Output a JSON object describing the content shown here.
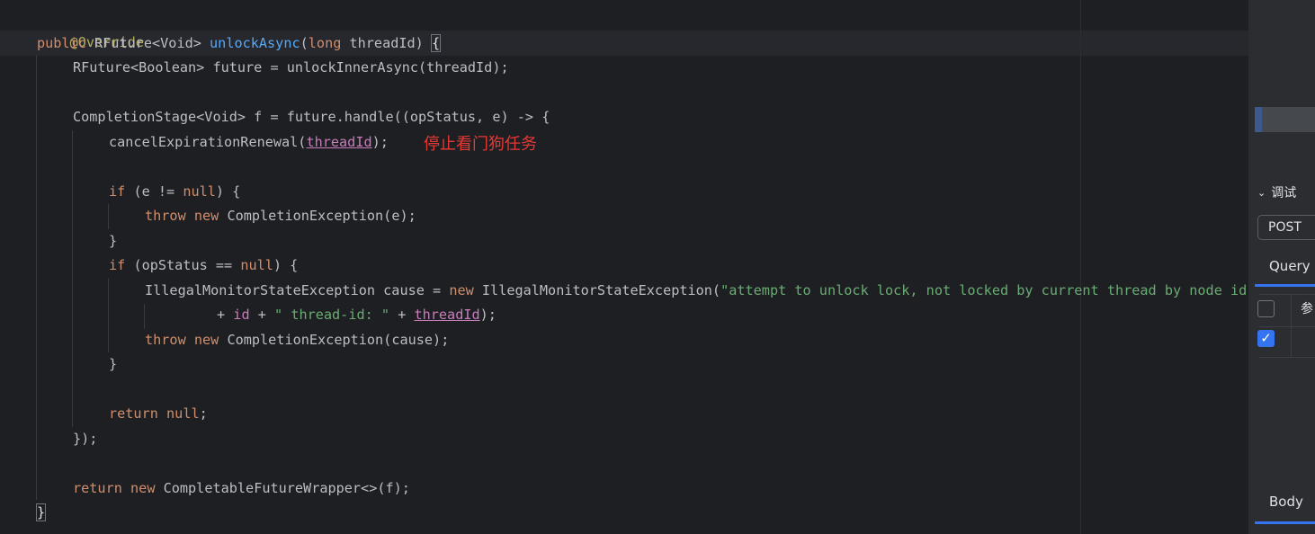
{
  "editor": {
    "lines": {
      "l1": [
        "@Override"
      ],
      "l2": [
        "public",
        " RFuture<Void> ",
        "unlockAsync",
        "(",
        "long",
        " threadId) ",
        "{"
      ],
      "l3": [
        "RFuture<Boolean> future = unlockInnerAsync(threadId);"
      ],
      "l5": [
        "CompletionStage<Void> f = future.handle((opStatus, e) -> {"
      ],
      "l6": [
        "cancelExpirationRenewal(",
        "threadId",
        ");"
      ],
      "l8": [
        "if",
        " (e != ",
        "null",
        ") {"
      ],
      "l9": [
        "throw",
        " ",
        "new",
        " CompletionException(e);"
      ],
      "l10": [
        "}"
      ],
      "l11": [
        "if",
        " (opStatus == ",
        "null",
        ") {"
      ],
      "l12": [
        "IllegalMonitorStateException cause = ",
        "new",
        " IllegalMonitorStateException(",
        "\"attempt to unlock lock, not locked by current thread by node id: \""
      ],
      "l13": [
        "+ ",
        "id",
        " + ",
        "\" thread-id: \"",
        " + ",
        "threadId",
        ");"
      ],
      "l14": [
        "throw",
        " ",
        "new",
        " CompletionException(cause);"
      ],
      "l15": [
        "}"
      ],
      "l17": [
        "return",
        " ",
        "null",
        ";"
      ],
      "l18": [
        "});"
      ],
      "l20": [
        "return",
        " ",
        "new",
        " CompletableFutureWrapper<>(f);"
      ],
      "l21": [
        "}"
      ]
    },
    "annotation": "停止看门狗任务"
  },
  "panel": {
    "section_label": "调试",
    "method": "POST",
    "tab_query": "Query",
    "param_header": "参",
    "tab_body": "Body",
    "row2_checked": true
  },
  "colors": {
    "background": "#1e1f22",
    "keyword": "#cf8e6d",
    "method": "#56a8f5",
    "annotation": "#b3ae60",
    "string": "#6aab73",
    "field": "#c77dbb",
    "comment_note": "#e53935",
    "accent": "#3574f0"
  }
}
